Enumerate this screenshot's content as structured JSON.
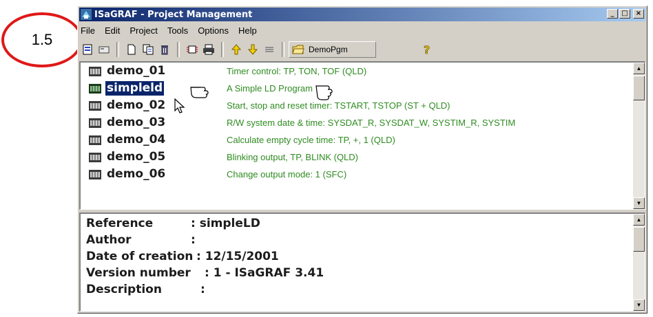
{
  "callout": {
    "label": "1.5"
  },
  "window": {
    "title": "ISaGRAF - Project Management",
    "controls": {
      "minimize": "_",
      "maximize": "□",
      "close": "×"
    }
  },
  "menu": [
    "File",
    "Edit",
    "Project",
    "Tools",
    "Options",
    "Help"
  ],
  "toolbar": {
    "icons": [
      "properties-icon",
      "card-icon",
      "new-icon",
      "copy-icon",
      "delete-icon",
      "io-connection-icon",
      "printer-icon",
      "move-up-icon",
      "move-down-icon",
      "compact-icon",
      "folder-icon",
      "help-icon"
    ],
    "group_label": "DemoPgm"
  },
  "programs": [
    {
      "name": "demo_01",
      "desc": "Timer control:  TP, TON, TOF  (QLD)",
      "selected": false
    },
    {
      "name": "simpleld",
      "desc": "A Simple LD Program",
      "selected": true
    },
    {
      "name": "demo_02",
      "desc": "Start, stop and reset timer:  TSTART, TSTOP  (ST + QLD)",
      "selected": false
    },
    {
      "name": "demo_03",
      "desc": "R/W system date & time:  SYSDAT_R, SYSDAT_W, SYSTIM_R, SYSTIM",
      "selected": false
    },
    {
      "name": "demo_04",
      "desc": "Calculate empty cycle time:  TP, +, 1  (QLD)",
      "selected": false
    },
    {
      "name": "demo_05",
      "desc": "Blinking output,  TP, BLINK  (QLD)",
      "selected": false
    },
    {
      "name": "demo_06",
      "desc": "Change output mode:  1  (SFC)",
      "selected": false
    }
  ],
  "info": {
    "reference": {
      "key": "Reference",
      "value": ": simpleLD"
    },
    "author": {
      "key": "Author",
      "value": ":"
    },
    "date": {
      "key": "Date of creation",
      "value": ": 12/15/2001"
    },
    "version": {
      "key": "Version number",
      "value": ": 1 - ISaGRAF 3.41"
    },
    "description": {
      "key": "Description",
      "value": ":"
    }
  },
  "colors": {
    "title_start": "#0a246a",
    "desc_text": "#2e8b20",
    "selection": "#0a246a",
    "callout": "#e01818"
  }
}
